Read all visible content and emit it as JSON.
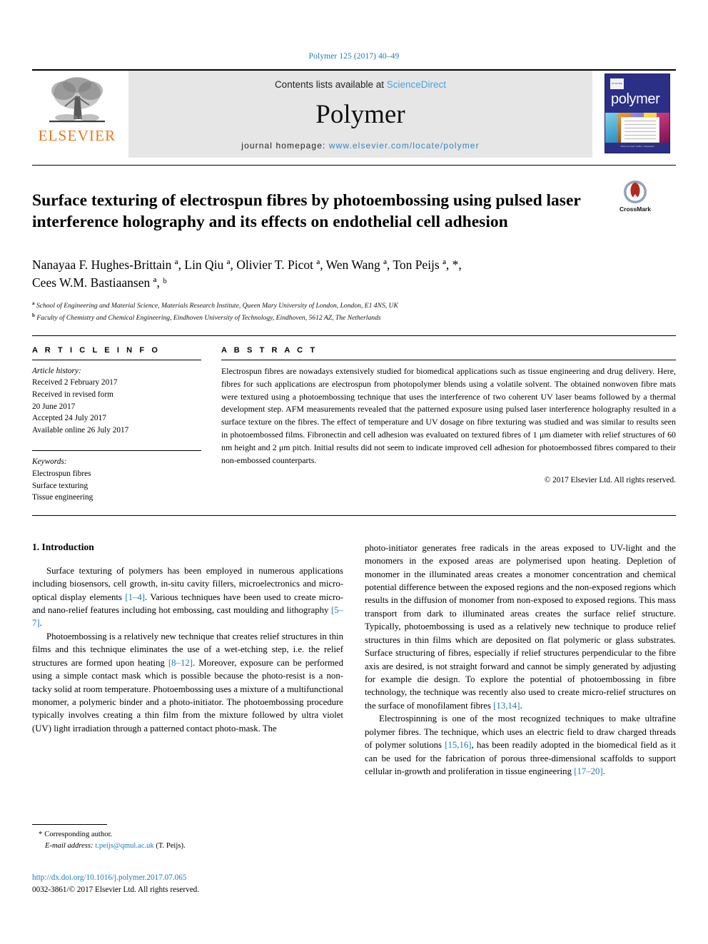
{
  "running_head": "Polymer 125 (2017) 40–49",
  "masthead": {
    "publisher_name": "ELSEVIER",
    "contents_prefix": "Contents lists available at ",
    "contents_link": "ScienceDirect",
    "journal_name": "Polymer",
    "homepage_prefix": "journal homepage: ",
    "homepage_url": "www.elsevier.com/locate/polymer",
    "cover": {
      "title": "polymer",
      "badge": "ELSEVIER",
      "footer": "Editor-in-Chief: Arthur J. Ragauskas"
    }
  },
  "article": {
    "title": "Surface texturing of electrospun fibres by photoembossing using pulsed laser interference holography and its effects on endothelial cell adhesion",
    "crossmark_label": "CrossMark",
    "authors_line_1": "Nanayaa F. Hughes-Brittain ª, Lin Qiu ª, Olivier T. Picot ª, Wen Wang ª, Ton Peijs ª, *,",
    "authors_line_2": "Cees W.M. Bastiaansen ª, ᵇ",
    "authors": [
      {
        "name": "Nanayaa F. Hughes-Brittain",
        "marks": "a"
      },
      {
        "name": "Lin Qiu",
        "marks": "a"
      },
      {
        "name": "Olivier T. Picot",
        "marks": "a"
      },
      {
        "name": "Wen Wang",
        "marks": "a"
      },
      {
        "name": "Ton Peijs",
        "marks": "a, *"
      },
      {
        "name": "Cees W.M. Bastiaansen",
        "marks": "a, b"
      }
    ],
    "affiliations": [
      {
        "mark": "a",
        "text": "School of Engineering and Material Science, Materials Research Institute, Queen Mary University of London, London, E1 4NS, UK"
      },
      {
        "mark": "b",
        "text": "Faculty of Chemistry and Chemical Engineering, Eindhoven University of Technology, Eindhoven, 5612 AZ, The Netherlands"
      }
    ]
  },
  "article_info": {
    "heading": "A R T I C L E   I N F O",
    "history_label": "Article history:",
    "history": [
      "Received 2 February 2017",
      "Received in revised form",
      "20 June 2017",
      "Accepted 24 July 2017",
      "Available online 26 July 2017"
    ],
    "keywords_label": "Keywords:",
    "keywords": [
      "Electrospun fibres",
      "Surface texturing",
      "Tissue engineering"
    ]
  },
  "abstract": {
    "heading": "A B S T R A C T",
    "text": "Electrospun fibres are nowadays extensively studied for biomedical applications such as tissue engineering and drug delivery. Here, fibres for such applications are electrospun from photopolymer blends using a volatile solvent. The obtained nonwoven fibre mats were textured using a photoembossing technique that uses the interference of two coherent UV laser beams followed by a thermal development step. AFM measurements revealed that the patterned exposure using pulsed laser interference holography resulted in a surface texture on the fibres. The effect of temperature and UV dosage on fibre texturing was studied and was similar to results seen in photoembossed films. Fibronectin and cell adhesion was evaluated on textured fibres of 1 μm diameter with relief structures of 60 nm height and 2 μm pitch. Initial results did not seem to indicate improved cell adhesion for photoembossed fibres compared to their non-embossed counterparts.",
    "copyright": "© 2017 Elsevier Ltd. All rights reserved."
  },
  "body": {
    "section_title": "1. Introduction",
    "left_paragraphs": [
      "Surface texturing of polymers has been employed in numerous applications including biosensors, cell growth, in-situ cavity fillers, microelectronics and micro-optical display elements [1–4]. Various techniques have been used to create micro- and nano-relief features including hot embossing, cast moulding and lithography [5–7].",
      "Photoembossing is a relatively new technique that creates relief structures in thin films and this technique eliminates the use of a wet-etching step, i.e. the relief structures are formed upon heating [8–12]. Moreover, exposure can be performed using a simple contact mask which is possible because the photo-resist is a non-tacky solid at room temperature. Photoembossing uses a mixture of a multifunctional monomer, a polymeric binder and a photo-initiator. The photoembossing procedure typically involves creating a thin film from the mixture followed by ultra violet (UV) light irradiation through a patterned contact photo-mask. The"
    ],
    "right_paragraphs": [
      "photo-initiator generates free radicals in the areas exposed to UV-light and the monomers in the exposed areas are polymerised upon heating. Depletion of monomer in the illuminated areas creates a monomer concentration and chemical potential difference between the exposed regions and the non-exposed regions which results in the diffusion of monomer from non-exposed to exposed regions. This mass transport from dark to illuminated areas creates the surface relief structure. Typically, photoembossing is used as a relatively new technique to produce relief structures in thin films which are deposited on flat polymeric or glass substrates. Surface structuring of fibres, especially if relief structures perpendicular to the fibre axis are desired, is not straight forward and cannot be simply generated by adjusting for example die design. To explore the potential of photoembossing in fibre technology, the technique was recently also used to create micro-relief structures on the surface of monofilament fibres [13,14].",
      "Electrospinning is one of the most recognized techniques to make ultrafine polymer fibres. The technique, which uses an electric field to draw charged threads of polymer solutions [15,16], has been readily adopted in the biomedical field as it can be used for the fabrication of porous three-dimensional scaffolds to support cellular in-growth and proliferation in tissue engineering [17–20]."
    ]
  },
  "footer": {
    "corresponding_marker": "*",
    "corresponding_label": "Corresponding author.",
    "email_label": "E-mail address:",
    "email": "t.peijs@qmul.ac.uk",
    "email_owner": "(T. Peijs).",
    "doi": "http://dx.doi.org/10.1016/j.polymer.2017.07.065",
    "issn_line": "0032-3861/© 2017 Elsevier Ltd. All rights reserved."
  },
  "colors": {
    "link_blue": "#1a7bb9",
    "elsevier_orange": "#E87722",
    "cover_blue": "#2c2f86",
    "masthead_gray": "#e6e6e6"
  }
}
